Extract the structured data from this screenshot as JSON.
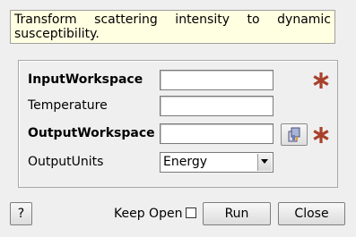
{
  "description": "Transform scattering intensity to dynamic susceptibility.",
  "properties": {
    "input_workspace": {
      "label": "InputWorkspace",
      "value": ""
    },
    "temperature": {
      "label": "Temperature",
      "value": ""
    },
    "output_workspace": {
      "label": "OutputWorkspace",
      "value": ""
    },
    "output_units": {
      "label": "OutputUnits",
      "selected": "Energy"
    }
  },
  "buttons": {
    "help": "?",
    "keep_open": "Keep Open",
    "run": "Run",
    "close": "Close"
  },
  "keep_open_checked": false,
  "colors": {
    "mandatory": "#a8412b",
    "description_bg": "#ffffe1"
  },
  "icons": {
    "mandatory": "mandatory-star-icon",
    "browse": "workspace-browse-icon",
    "dropdown": "chevron-down-icon"
  }
}
